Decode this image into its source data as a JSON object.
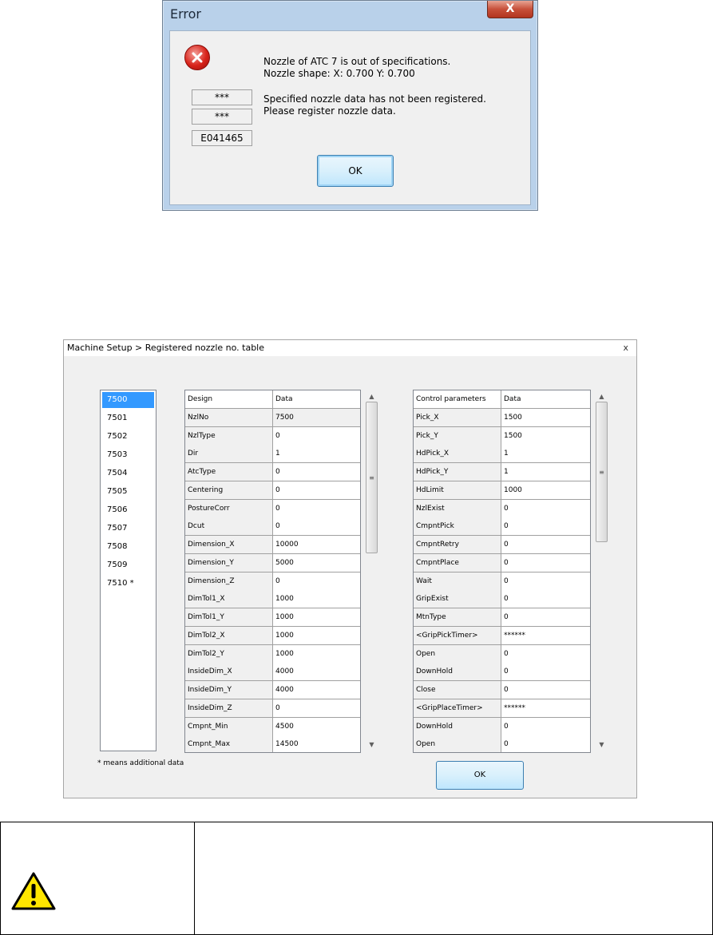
{
  "error_dialog": {
    "title": "Error",
    "close_label": "X",
    "codes": [
      "***",
      "***",
      "E041465"
    ],
    "message_lines": [
      "Nozzle of ATC 7 is out of specifications.",
      "Nozzle shape: X:  0.700 Y:  0.700",
      "Specified nozzle data has not been registered.",
      "Please register nozzle data."
    ],
    "ok_label": "OK"
  },
  "nozzle_table": {
    "breadcrumb": "Machine Setup > Registered nozzle no. table",
    "close_label": "x",
    "nozzles": [
      "7500",
      "7501",
      "7502",
      "7503",
      "7504",
      "7505",
      "7506",
      "7507",
      "7508",
      "7509",
      "7510 *"
    ],
    "selected_nozzle": "7500",
    "note": "* means additional data",
    "design_table": {
      "headers": [
        "Design",
        "Data"
      ],
      "rows": [
        [
          "NzlNo",
          "7500"
        ],
        [
          "NzlType",
          "0"
        ],
        [
          "Dir",
          "1"
        ],
        [
          "AtcType",
          "0"
        ],
        [
          "Centering",
          "0"
        ],
        [
          "PostureCorr",
          "0"
        ],
        [
          "Dcut",
          "0"
        ],
        [
          "Dimension_X",
          "10000"
        ],
        [
          "Dimension_Y",
          "5000"
        ],
        [
          "Dimension_Z",
          "0"
        ],
        [
          "DimTol1_X",
          "1000"
        ],
        [
          "DimTol1_Y",
          "1000"
        ],
        [
          "DimTol2_X",
          "1000"
        ],
        [
          "DimTol2_Y",
          "1000"
        ],
        [
          "InsideDim_X",
          "4000"
        ],
        [
          "InsideDim_Y",
          "4000"
        ],
        [
          "InsideDim_Z",
          "0"
        ],
        [
          "Cmpnt_Min",
          "4500"
        ],
        [
          "Cmpnt_Max",
          "14500"
        ]
      ]
    },
    "control_table": {
      "headers": [
        "Control parameters",
        "Data"
      ],
      "rows": [
        [
          "Pick_X",
          "1500"
        ],
        [
          "Pick_Y",
          "1500"
        ],
        [
          "HdPick_X",
          "1"
        ],
        [
          "HdPick_Y",
          "1"
        ],
        [
          "HdLimit",
          "1000"
        ],
        [
          "NzlExist",
          "0"
        ],
        [
          "CmpntPick",
          "0"
        ],
        [
          "CmpntRetry",
          "0"
        ],
        [
          "CmpntPlace",
          "0"
        ],
        [
          "Wait",
          "0"
        ],
        [
          "GripExist",
          "0"
        ],
        [
          "MtnType",
          "0"
        ],
        [
          "<GripPickTimer>",
          "******"
        ],
        [
          "Open",
          "0"
        ],
        [
          "DownHold",
          "0"
        ],
        [
          "Close",
          "0"
        ],
        [
          "<GripPlaceTimer>",
          "******"
        ],
        [
          "DownHold",
          "0"
        ],
        [
          "Open",
          "0"
        ]
      ]
    },
    "ok_label": "OK",
    "scroll_up": "▲",
    "scroll_down": "▼",
    "scroll_grip": "≡"
  },
  "caution": {
    "icon": "warning-icon"
  }
}
